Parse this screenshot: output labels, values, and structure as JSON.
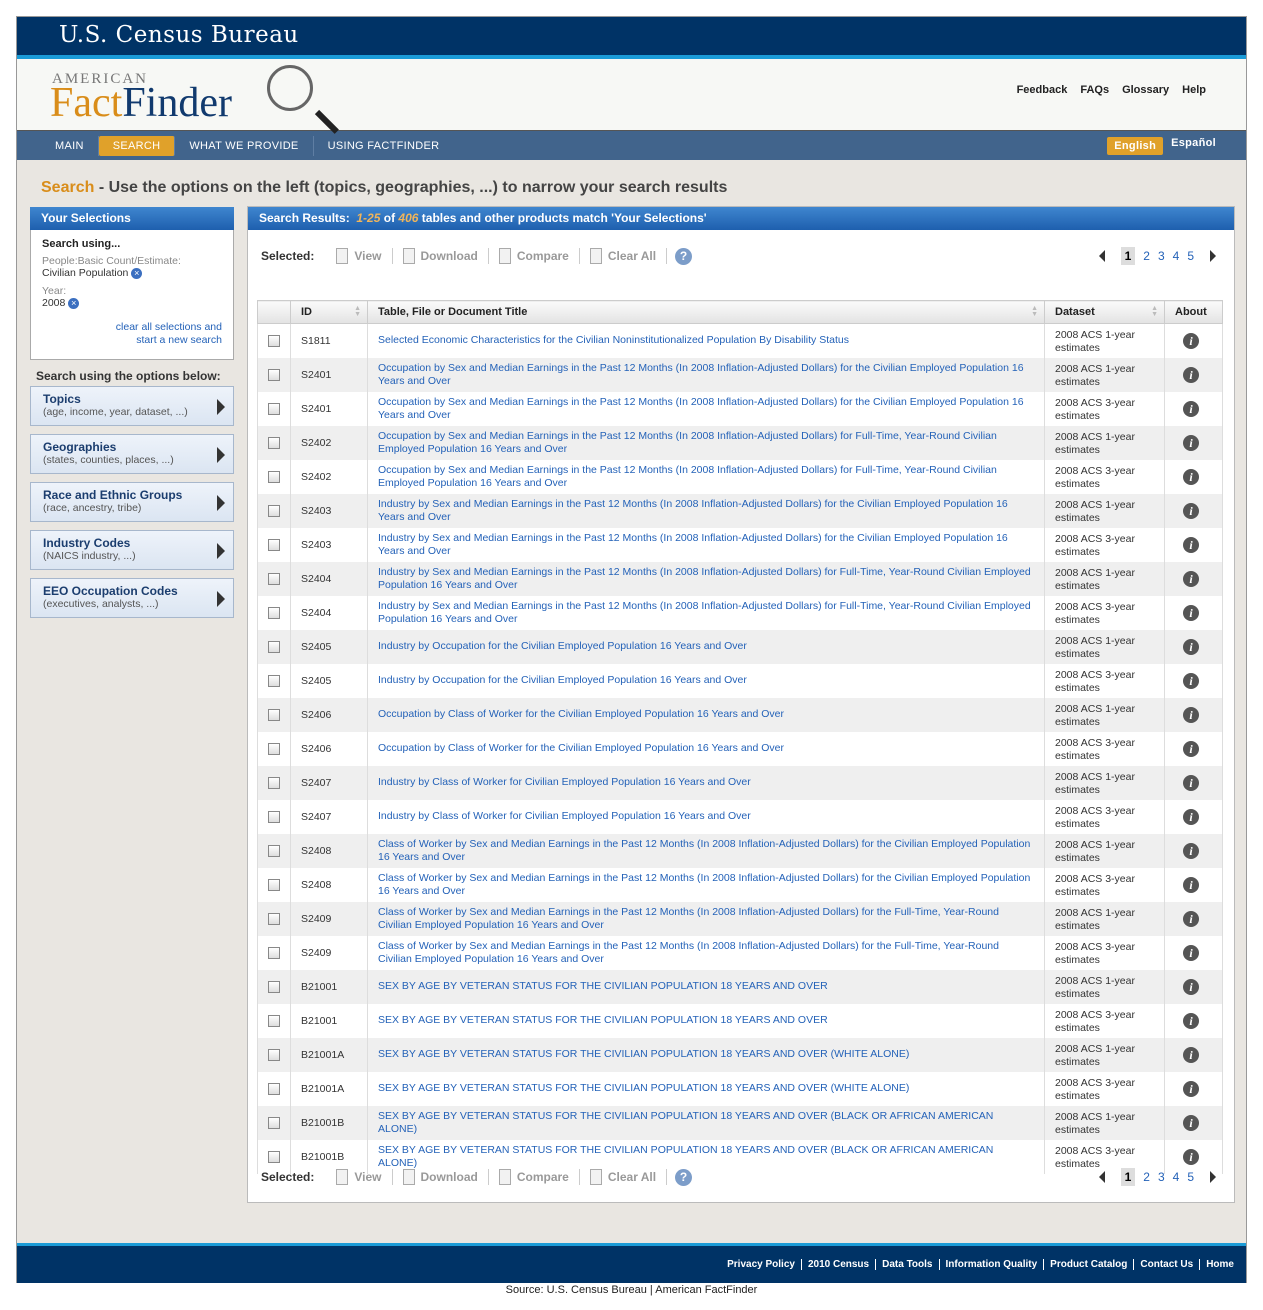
{
  "header": {
    "agency": "U.S. Census Bureau",
    "logo_small": "AMERICAN",
    "logo_fact": "Fact",
    "logo_finder": "Finder",
    "util_links": [
      "Feedback",
      "FAQs",
      "Glossary",
      "Help"
    ]
  },
  "nav": {
    "items": [
      "MAIN",
      "SEARCH",
      "WHAT WE PROVIDE",
      "USING FACTFINDER"
    ],
    "active": "SEARCH",
    "languages": [
      "English",
      "Español"
    ]
  },
  "headline": {
    "search": "Search",
    "text": " - Use the options on the left (topics, geographies, ...) to narrow your search results"
  },
  "selections": {
    "title": "Your Selections",
    "search_using": "Search using...",
    "people_label": "People:Basic Count/Estimate:",
    "people_value": "Civilian Population",
    "year_label": "Year:",
    "year_value": "2008",
    "clear1": "clear all selections and",
    "clear2": "start a new search"
  },
  "options": {
    "title": "Search using the options below:",
    "items": [
      {
        "title": "Topics",
        "desc": "(age, income, year, dataset, ...)"
      },
      {
        "title": "Geographies",
        "desc": "(states, counties, places, ...)"
      },
      {
        "title": "Race and Ethnic Groups",
        "desc": "(race, ancestry, tribe)"
      },
      {
        "title": "Industry Codes",
        "desc": "(NAICS industry, ...)"
      },
      {
        "title": "EEO Occupation Codes",
        "desc": "(executives, analysts, ...)"
      }
    ]
  },
  "results": {
    "prefix": "Search Results:",
    "range": "1-25",
    "of": " of ",
    "total": "406",
    "suffix": " tables and other products match 'Your Selections'",
    "toolbar": {
      "selected": "Selected:",
      "view": "View",
      "download": "Download",
      "compare": "Compare",
      "clear": "Clear All",
      "help": "?"
    },
    "pages": [
      "1",
      "2",
      "3",
      "4",
      "5"
    ],
    "current_page": "1",
    "columns": [
      "ID",
      "Table, File or Document Title",
      "Dataset",
      "About"
    ],
    "rows": [
      [
        "S1811",
        "Selected Economic Characteristics for the Civilian Noninstitutionalized Population By Disability Status",
        "2008 ACS 1-year estimates"
      ],
      [
        "S2401",
        "Occupation by Sex and Median Earnings in the Past 12 Months (In 2008 Inflation-Adjusted Dollars) for the Civilian Employed Population 16 Years and Over",
        "2008 ACS 1-year estimates"
      ],
      [
        "S2401",
        "Occupation by Sex and Median Earnings in the Past 12 Months (In 2008 Inflation-Adjusted Dollars) for the Civilian Employed Population 16 Years and Over",
        "2008 ACS 3-year estimates"
      ],
      [
        "S2402",
        "Occupation by Sex and Median Earnings in the Past 12 Months (In 2008 Inflation-Adjusted Dollars) for Full-Time, Year-Round Civilian Employed Population 16 Years and Over",
        "2008 ACS 1-year estimates"
      ],
      [
        "S2402",
        "Occupation by Sex and Median Earnings in the Past 12 Months (In 2008 Inflation-Adjusted Dollars) for Full-Time, Year-Round Civilian Employed Population 16 Years and Over",
        "2008 ACS 3-year estimates"
      ],
      [
        "S2403",
        "Industry by Sex and Median Earnings in the Past 12 Months (In 2008 Inflation-Adjusted Dollars) for the Civilian Employed Population 16 Years and Over",
        "2008 ACS 1-year estimates"
      ],
      [
        "S2403",
        "Industry by Sex and Median Earnings in the Past 12 Months (In 2008 Inflation-Adjusted Dollars) for the Civilian Employed Population 16 Years and Over",
        "2008 ACS 3-year estimates"
      ],
      [
        "S2404",
        "Industry by Sex and Median Earnings in the Past 12 Months (In 2008 Inflation-Adjusted Dollars) for Full-Time, Year-Round Civilian Employed Population 16 Years and Over",
        "2008 ACS 1-year estimates"
      ],
      [
        "S2404",
        "Industry by Sex and Median Earnings in the Past 12 Months (In 2008 Inflation-Adjusted Dollars) for Full-Time, Year-Round Civilian Employed Population 16 Years and Over",
        "2008 ACS 3-year estimates"
      ],
      [
        "S2405",
        "Industry by Occupation for the Civilian Employed Population 16 Years and Over",
        "2008 ACS 1-year estimates"
      ],
      [
        "S2405",
        "Industry by Occupation for the Civilian Employed Population 16 Years and Over",
        "2008 ACS 3-year estimates"
      ],
      [
        "S2406",
        "Occupation by Class of Worker for the Civilian Employed Population 16 Years and Over",
        "2008 ACS 1-year estimates"
      ],
      [
        "S2406",
        "Occupation by Class of Worker for the Civilian Employed Population 16 Years and Over",
        "2008 ACS 3-year estimates"
      ],
      [
        "S2407",
        "Industry by Class of Worker for Civilian Employed Population 16 Years and Over",
        "2008 ACS 1-year estimates"
      ],
      [
        "S2407",
        "Industry by Class of Worker for Civilian Employed Population 16 Years and Over",
        "2008 ACS 3-year estimates"
      ],
      [
        "S2408",
        "Class of Worker by Sex and Median Earnings in the Past 12 Months (In 2008 Inflation-Adjusted Dollars) for the Civilian Employed Population 16 Years and Over",
        "2008 ACS 1-year estimates"
      ],
      [
        "S2408",
        "Class of Worker by Sex and Median Earnings in the Past 12 Months (In 2008 Inflation-Adjusted Dollars) for the Civilian Employed Population 16 Years and Over",
        "2008 ACS 3-year estimates"
      ],
      [
        "S2409",
        "Class of Worker by Sex and Median Earnings in the Past 12 Months (In 2008 Inflation-Adjusted Dollars) for the Full-Time, Year-Round Civilian Employed Population 16 Years and Over",
        "2008 ACS 1-year estimates"
      ],
      [
        "S2409",
        "Class of Worker by Sex and Median Earnings in the Past 12 Months (In 2008 Inflation-Adjusted Dollars) for the Full-Time, Year-Round Civilian Employed Population 16 Years and Over",
        "2008 ACS 3-year estimates"
      ],
      [
        "B21001",
        "SEX BY AGE BY VETERAN STATUS FOR THE CIVILIAN POPULATION 18 YEARS AND OVER",
        "2008 ACS 1-year estimates"
      ],
      [
        "B21001",
        "SEX BY AGE BY VETERAN STATUS FOR THE CIVILIAN POPULATION 18 YEARS AND OVER",
        "2008 ACS 3-year estimates"
      ],
      [
        "B21001A",
        "SEX BY AGE BY VETERAN STATUS FOR THE CIVILIAN POPULATION 18 YEARS AND OVER (WHITE ALONE)",
        "2008 ACS 1-year estimates"
      ],
      [
        "B21001A",
        "SEX BY AGE BY VETERAN STATUS FOR THE CIVILIAN POPULATION 18 YEARS AND OVER (WHITE ALONE)",
        "2008 ACS 3-year estimates"
      ],
      [
        "B21001B",
        "SEX BY AGE BY VETERAN STATUS FOR THE CIVILIAN POPULATION 18 YEARS AND OVER (BLACK OR AFRICAN AMERICAN ALONE)",
        "2008 ACS 1-year estimates"
      ],
      [
        "B21001B",
        "SEX BY AGE BY VETERAN STATUS FOR THE CIVILIAN POPULATION 18 YEARS AND OVER (BLACK OR AFRICAN AMERICAN ALONE)",
        "2008 ACS 3-year estimates"
      ]
    ]
  },
  "footer": {
    "links": [
      "Privacy Policy",
      "2010 Census",
      "Data Tools",
      "Information Quality",
      "Product Catalog",
      "Contact Us",
      "Home"
    ],
    "source": "Source: U.S. Census Bureau  |  American FactFinder"
  },
  "colors": {
    "navy": "#003366",
    "accent_orange": "#e0a12a",
    "link_blue": "#2462b8",
    "nav_blue": "#41648c"
  }
}
